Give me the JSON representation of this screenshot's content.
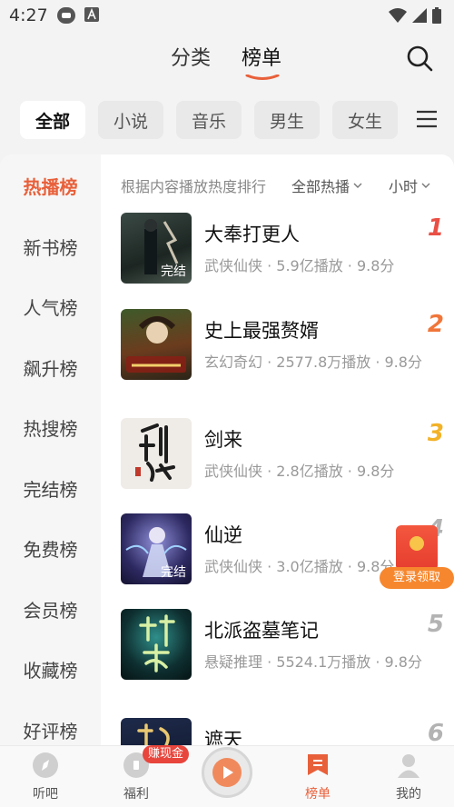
{
  "status": {
    "time": "4:27"
  },
  "top_tabs": [
    {
      "label": "分类"
    },
    {
      "label": "榜单"
    }
  ],
  "chips": [
    {
      "label": "全部"
    },
    {
      "label": "小说"
    },
    {
      "label": "音乐"
    },
    {
      "label": "男生"
    },
    {
      "label": "女生"
    }
  ],
  "sidebar": [
    "热播榜",
    "新书榜",
    "人气榜",
    "飙升榜",
    "热搜榜",
    "完结榜",
    "免费榜",
    "会员榜",
    "收藏榜",
    "好评榜"
  ],
  "ranking": {
    "description": "根据内容播放热度排行",
    "filter_scope": "全部热播",
    "filter_time": "小时",
    "items": [
      {
        "rank": "1",
        "title": "大奉打更人",
        "meta": "武侠仙侠 · 5.9亿播放 · 9.8分",
        "badge": "完结",
        "rank_color": "#e94f45"
      },
      {
        "rank": "2",
        "title": "史上最强赘婿",
        "meta": "玄幻奇幻 · 2577.8万播放 · 9.8分",
        "badge": "",
        "rank_color": "#f0763a"
      },
      {
        "rank": "3",
        "title": "剑来",
        "meta": "武侠仙侠 · 2.8亿播放 · 9.8分",
        "badge": "",
        "rank_color": "#f2b229"
      },
      {
        "rank": "4",
        "title": "仙逆",
        "meta": "武侠仙侠 · 3.0亿播放 · 9.8分",
        "badge": "完结",
        "rank_color": "#b3b3b3"
      },
      {
        "rank": "5",
        "title": "北派盗墓笔记",
        "meta": "悬疑推理 · 5524.1万播放 · 9.8分",
        "badge": "",
        "rank_color": "#b3b3b3"
      },
      {
        "rank": "6",
        "title": "遮天",
        "meta": "",
        "badge": "",
        "rank_color": "#b3b3b3"
      }
    ]
  },
  "floating": {
    "label": "登录领取"
  },
  "bottom_nav": [
    {
      "label": "听吧"
    },
    {
      "label": "福利"
    },
    {
      "label": "榜单"
    },
    {
      "label": "我的"
    }
  ],
  "earn_badge": "赚现金",
  "colors": {
    "accent": "#e8603a"
  }
}
